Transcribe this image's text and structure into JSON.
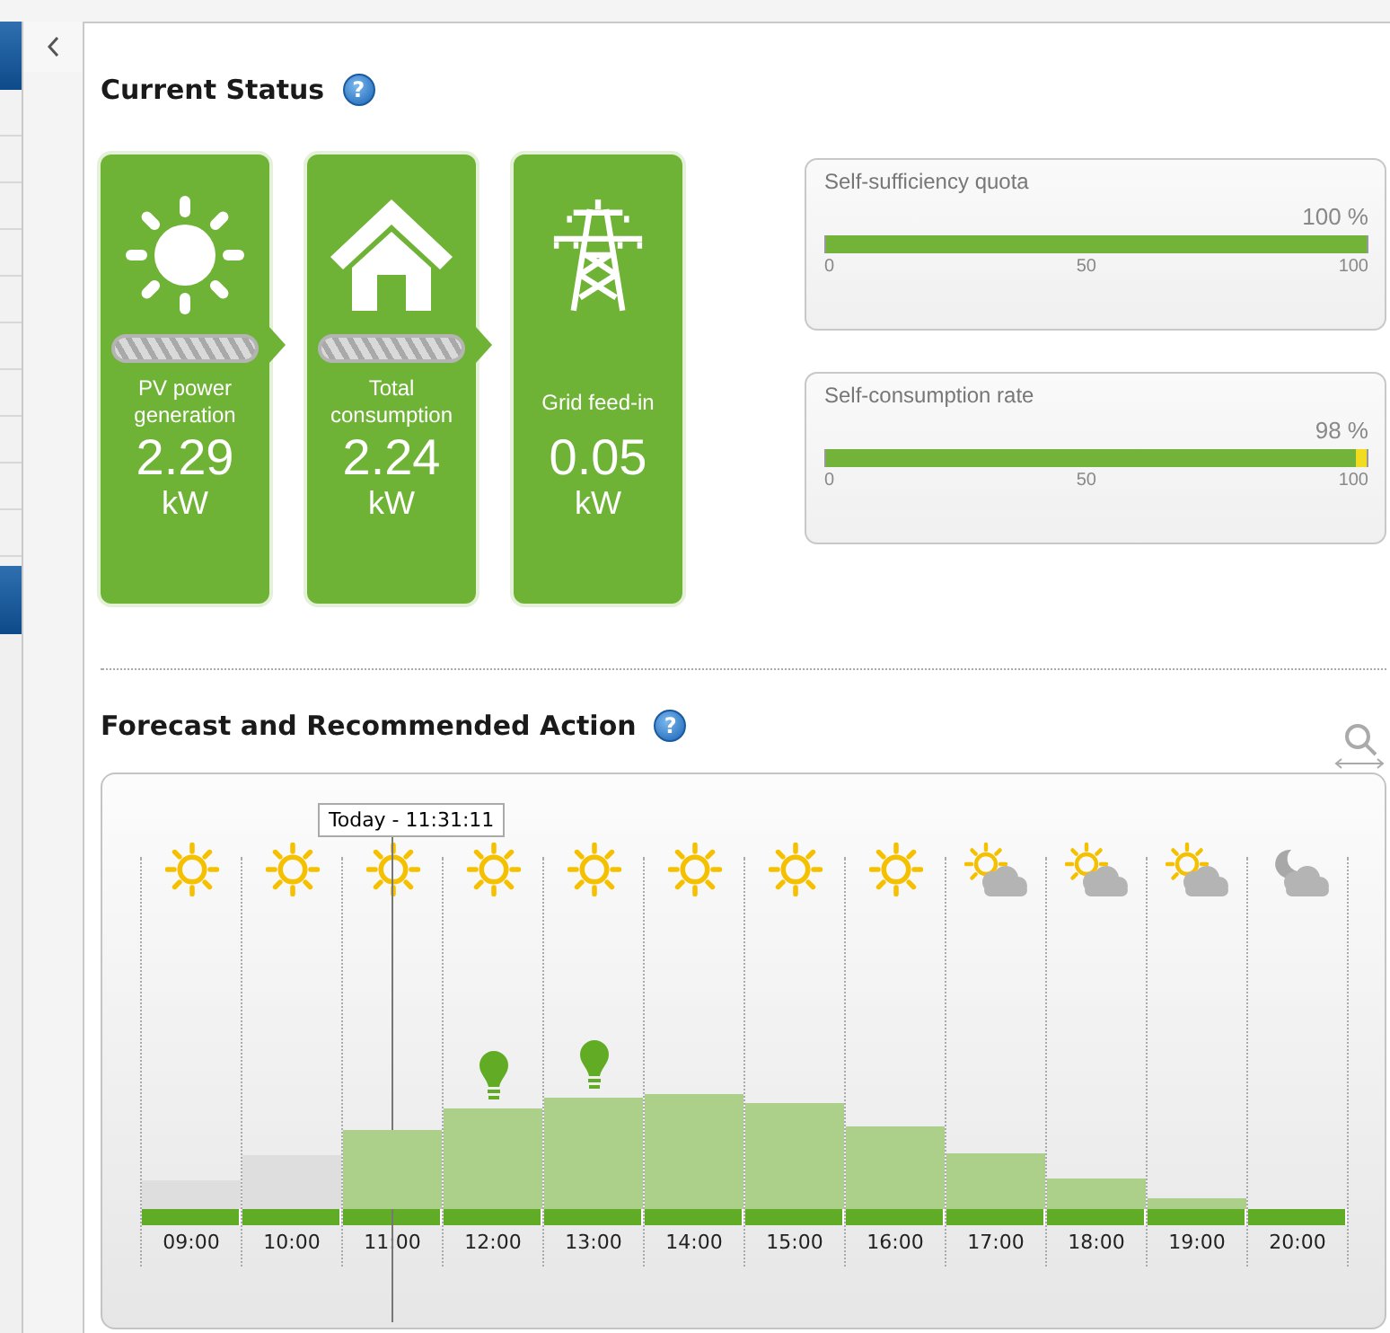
{
  "sidebar": {
    "tabs": [
      {
        "selected": true
      },
      {
        "selected": true
      }
    ]
  },
  "current_status": {
    "title": "Current Status",
    "help": "?",
    "cards": [
      {
        "kind": "sun",
        "flow": true,
        "label": "PV power generation",
        "value": "2.29",
        "unit": "kW"
      },
      {
        "kind": "house",
        "flow": true,
        "label": "Total consumption",
        "value": "2.24",
        "unit": "kW"
      },
      {
        "kind": "pylon",
        "flow": false,
        "label": "Grid feed-in",
        "value": "0.05",
        "unit": "kW"
      }
    ],
    "meters": [
      {
        "title": "Self-sufficiency quota",
        "reading": "100 %",
        "level": 1.0,
        "ticks": [
          "0",
          "50",
          "100"
        ]
      },
      {
        "title": "Self-consumption rate",
        "reading": "98 %",
        "level": 0.98,
        "ticks": [
          "0",
          "50",
          "100"
        ]
      }
    ]
  },
  "forecast": {
    "title": "Forecast and Recommended Action",
    "help": "?",
    "now_label": "Today - 11:31:11",
    "columns": [
      {
        "time": "09:00",
        "kind": "sun",
        "past": true,
        "now": false,
        "recommended": false
      },
      {
        "time": "10:00",
        "kind": "sun",
        "past": true,
        "now": false,
        "recommended": false
      },
      {
        "time": "11:00",
        "kind": "sun",
        "past": false,
        "now": true,
        "recommended": false
      },
      {
        "time": "12:00",
        "kind": "sun",
        "past": false,
        "now": false,
        "recommended": true
      },
      {
        "time": "13:00",
        "kind": "sun",
        "past": false,
        "now": false,
        "recommended": true
      },
      {
        "time": "14:00",
        "kind": "sun",
        "past": false,
        "now": false,
        "recommended": false
      },
      {
        "time": "15:00",
        "kind": "sun",
        "past": false,
        "now": false,
        "recommended": false
      },
      {
        "time": "16:00",
        "kind": "sun",
        "past": false,
        "now": false,
        "recommended": false
      },
      {
        "time": "17:00",
        "kind": "sun-cloud",
        "past": false,
        "now": false,
        "recommended": false
      },
      {
        "time": "18:00",
        "kind": "sun-cloud",
        "past": false,
        "now": false,
        "recommended": false
      },
      {
        "time": "19:00",
        "kind": "sun-cloud",
        "past": false,
        "now": false,
        "recommended": false
      },
      {
        "time": "20:00",
        "kind": "moon-cloud",
        "now": false,
        "recommended": false
      }
    ]
  }
}
